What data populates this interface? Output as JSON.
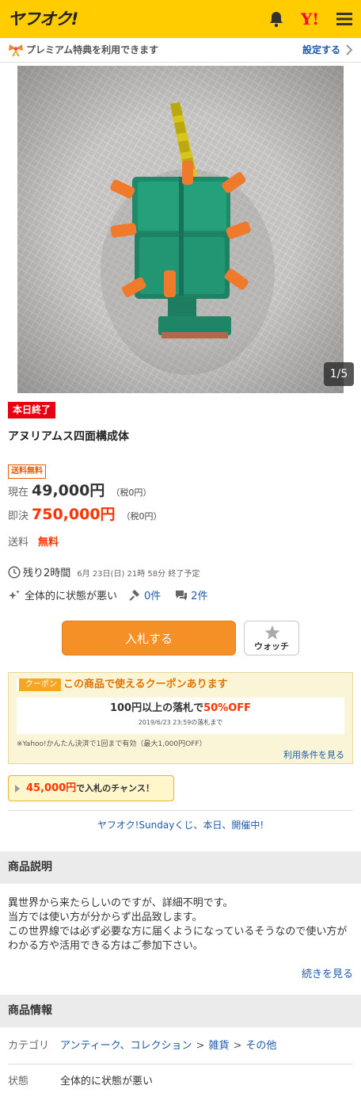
{
  "header": {
    "logo_text": "ヤフオク!",
    "yahoo_mark": "Y!",
    "icons": [
      "bell-icon",
      "yahoo-japan-icon",
      "menu-icon"
    ]
  },
  "premium": {
    "text": "プレミアム特典を利用できます",
    "link": "設定する"
  },
  "gallery": {
    "counter": "1/5"
  },
  "item": {
    "ended_badge": "本日終了",
    "title": "アヌリアムス四面構成体",
    "free_shipping_badge": "送料無料",
    "current_label": "現在",
    "current_price": "49,000円",
    "current_tax": "（税0円）",
    "buynow_label": "即決",
    "buynow_price": "750,000円",
    "buynow_tax": "（税0円）",
    "shipping_label": "送料",
    "shipping_value": "無料",
    "remaining": "残り2時間",
    "end_time": "6月 23日(日) 21時 58分 終了予定",
    "condition": "全体的に状態が悪い",
    "bids": "0件",
    "questions": "2件"
  },
  "actions": {
    "bid_button": "入札する",
    "watch_button": "ウォッチ"
  },
  "coupon": {
    "tag": "クーポン",
    "headline": "この商品で使えるクーポンあります",
    "main_prefix": "100円以上の落札で",
    "main_off": "50%OFF",
    "deadline": "2019/6/23 23:59の落札まで",
    "note": "※Yahoo!かんたん決済で1回まで有効（最大1,000円OFF）",
    "terms_link": "利用条件を見る"
  },
  "chance": {
    "amount": "45,000円",
    "suffix": "で入札のチャンス！"
  },
  "sunday_link": "ヤフオク!Sundayくじ、本日、開催中!",
  "description": {
    "heading": "商品説明",
    "lines": [
      "異世界から来たらしいのですが、詳細不明です。",
      "当方では使い方が分からず出品致します。",
      "この世界線では必ず必要な方に届くようになっているそうなので使い方がわかる方や活用できる方はご参加下さい。"
    ],
    "more_link": "続きを見る"
  },
  "info": {
    "heading": "商品情報",
    "category_label": "カテゴリ",
    "category_path": [
      "アンティーク、コレクション",
      "雑貨",
      "その他"
    ],
    "condition_label": "状態",
    "condition_value": "全体的に状態が悪い"
  },
  "colors": {
    "brand_yellow": "#ffcc00",
    "bid_orange": "#f59027",
    "price_red": "#ff3300",
    "link_blue": "#1e5aa8"
  }
}
